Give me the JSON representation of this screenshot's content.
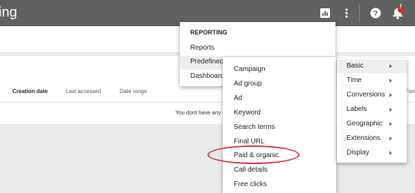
{
  "header": {
    "title_fragment": "ing",
    "notification_count": "!"
  },
  "table": {
    "columns": [
      "Creation date",
      "Last accessed",
      "Date range"
    ],
    "partial_column": "Forn",
    "empty_message": "You dont have any reports"
  },
  "reporting_menu": {
    "heading": "REPORTING",
    "items": [
      "Reports",
      "Predefined",
      "Dashboard"
    ]
  },
  "predefined_menu": {
    "items": [
      "Campaign",
      "Ad group",
      "Ad",
      "Keyword",
      "Search terms",
      "Final URL",
      "Paid & organic",
      "Call details",
      "Free clicks"
    ]
  },
  "basic_menu": {
    "items": [
      "Basic",
      "Time",
      "Conversions",
      "Labels",
      "Geographic",
      "Extensions",
      "Display"
    ]
  },
  "colors": {
    "topbar": "#616161",
    "annotation": "#d32f2f",
    "notification_badge": "#d32f2f"
  },
  "icons": [
    "reports-icon",
    "more-vert-icon",
    "help-icon",
    "notifications-icon",
    "chevron-right-icon"
  ]
}
